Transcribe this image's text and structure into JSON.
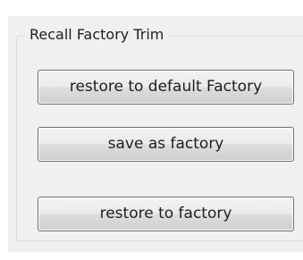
{
  "group": {
    "title": "Recall Factory Trim"
  },
  "buttons": {
    "restore_default": "restore to default Factory",
    "save_factory": "save as factory",
    "restore_factory": "restore to factory"
  }
}
